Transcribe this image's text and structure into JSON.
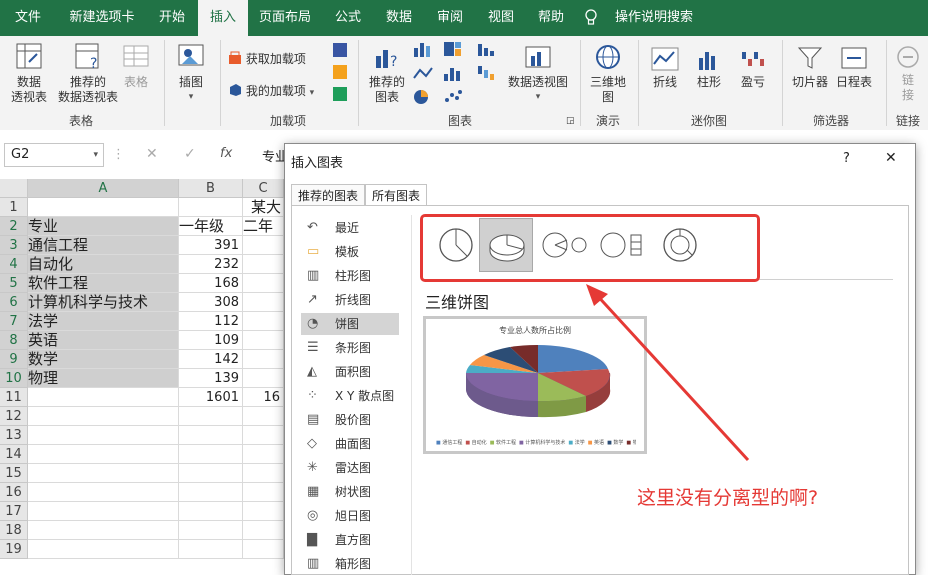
{
  "ribbon": {
    "tabs": [
      "文件",
      "新建选项卡",
      "开始",
      "插入",
      "页面布局",
      "公式",
      "数据",
      "审阅",
      "视图",
      "帮助",
      "操作说明搜索"
    ],
    "active_tab": "插入",
    "groups": {
      "tables": {
        "label": "表格",
        "pivot": "数据\n透视表",
        "rec_pivot": "推荐的\n数据透视表",
        "table": "表格"
      },
      "illus": {
        "label": "插图"
      },
      "addins": {
        "label": "加载项",
        "get": "获取加载项",
        "my": "我的加载项"
      },
      "charts": {
        "label": "图表",
        "rec": "推荐的\n图表",
        "pivotchart": "数据透视图"
      },
      "tours": {
        "label": "演示",
        "map3d": "三维地\n图"
      },
      "spark": {
        "label": "迷你图",
        "line": "折线",
        "column": "柱形",
        "winloss": "盈亏"
      },
      "filters": {
        "label": "筛选器",
        "slicer": "切片器",
        "timeline": "日程表"
      },
      "links": {
        "label": "链接",
        "link": "链\n接"
      }
    }
  },
  "formula_bar": {
    "name_box": "G2",
    "content": "专业"
  },
  "sheet": {
    "columns": [
      "A",
      "B",
      "C"
    ],
    "row_numbers": [
      "1",
      "2",
      "3",
      "4",
      "5",
      "6",
      "7",
      "8",
      "9",
      "10",
      "11",
      "12",
      "13",
      "14",
      "15",
      "16",
      "17",
      "18",
      "19"
    ],
    "title_partial": "某大",
    "rows": [
      {
        "a": "专业",
        "b": "一年级",
        "c": "二年"
      },
      {
        "a": "通信工程",
        "b": "391",
        "c": ""
      },
      {
        "a": "自动化",
        "b": "232",
        "c": ""
      },
      {
        "a": "软件工程",
        "b": "168",
        "c": ""
      },
      {
        "a": "计算机科学与技术",
        "b": "308",
        "c": ""
      },
      {
        "a": "法学",
        "b": "112",
        "c": ""
      },
      {
        "a": "英语",
        "b": "109",
        "c": ""
      },
      {
        "a": "数学",
        "b": "142",
        "c": ""
      },
      {
        "a": "物理",
        "b": "139",
        "c": ""
      },
      {
        "a": "",
        "b": "1601",
        "c": "16"
      }
    ]
  },
  "dialog": {
    "title": "插入图表",
    "help": "?",
    "close": "✕",
    "tabs": [
      "推荐的图表",
      "所有图表"
    ],
    "active_tab": "所有图表",
    "chart_types": [
      "最近",
      "模板",
      "柱形图",
      "折线图",
      "饼图",
      "条形图",
      "面积图",
      "X Y 散点图",
      "股价图",
      "曲面图",
      "雷达图",
      "树状图",
      "旭日图",
      "直方图",
      "箱形图"
    ],
    "selected_type": "饼图",
    "variants_selected": 1,
    "section_title": "三维饼图",
    "preview": {
      "title": "专业总人数所占比例",
      "legend": [
        "通信工程",
        "自动化",
        "软件工程",
        "计算机科学与技术",
        "法学",
        "英语",
        "数学",
        "物理"
      ],
      "colors": [
        "#4f81bd",
        "#c0504d",
        "#9bbb59",
        "#8064a2",
        "#4bacc6",
        "#f79646",
        "#2c4d75",
        "#772c2a"
      ]
    }
  },
  "annotation": "这里没有分离型的啊?"
}
